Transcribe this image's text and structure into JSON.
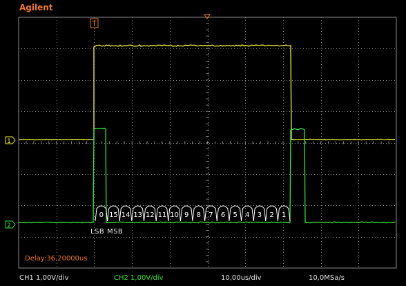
{
  "brand": "Agilent",
  "trigger_marker": "T",
  "ch1_marker": "1",
  "ch2_marker": "2",
  "bus": {
    "bits": [
      "0",
      "15",
      "14",
      "13",
      "12",
      "11",
      "10",
      "9",
      "8",
      "7",
      "6",
      "5",
      "4",
      "3",
      "2",
      "1"
    ],
    "order_label": "LSB  MSB"
  },
  "delay": "Delay:36.20000us",
  "status": {
    "ch1": "CH1 1,00V/div",
    "ch2": "CH2 1,00V/div",
    "timebase": "10,00us/div",
    "samplerate": "10,0MSa/s"
  },
  "colors": {
    "ch1": "#f5f532",
    "ch2": "#32e632",
    "brand": "#f07828",
    "grid": "#8c8c8c"
  }
}
